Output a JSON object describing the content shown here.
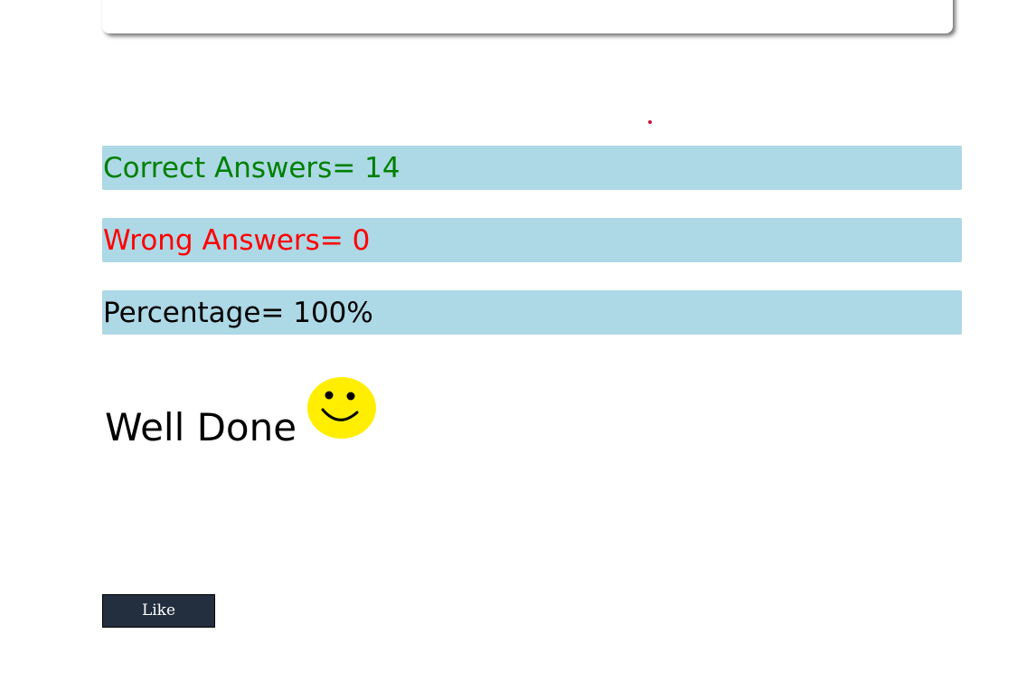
{
  "results": {
    "correct_label": "Correct Answers= 14",
    "wrong_label": "Wrong Answers= 0",
    "percentage_label": "Percentage= 100%",
    "correct_count": 14,
    "wrong_count": 0,
    "percentage": 100
  },
  "message": {
    "text": "Well Done",
    "icon": "smiley-face-icon"
  },
  "like_button": {
    "label": "Like"
  },
  "colors": {
    "bar_background": "#add8e6",
    "correct_text": "#008000",
    "wrong_text": "#ff0000",
    "percentage_text": "#000000",
    "smiley_fill": "#ffee00",
    "button_background": "#232f3e",
    "button_text": "#ffffff"
  }
}
